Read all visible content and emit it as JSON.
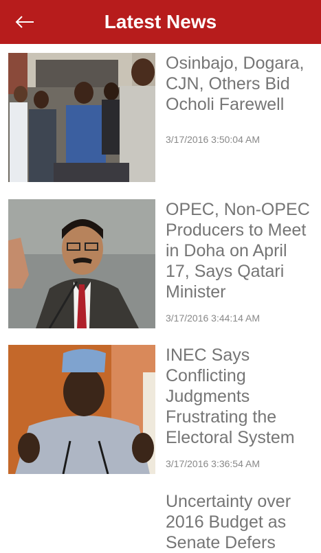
{
  "header": {
    "title": "Latest News",
    "back_icon": "arrow-left-icon",
    "background_color": "#b71c1c"
  },
  "articles": [
    {
      "headline": "Osinbajo, Dogara, CJN, Others Bid Ocholi Farewell",
      "timestamp": "3/17/2016 3:50:04 AM"
    },
    {
      "headline": "OPEC, Non-OPEC Producers to Meet in Doha on April 17, Says Qatari Minister",
      "timestamp": "3/17/2016 3:44:14 AM"
    },
    {
      "headline": "INEC Says Conflicting Judgments Frustrating the Electoral System",
      "timestamp": "3/17/2016 3:36:54 AM"
    },
    {
      "headline": "Uncertainty over 2016 Budget as Senate Defers"
    }
  ]
}
